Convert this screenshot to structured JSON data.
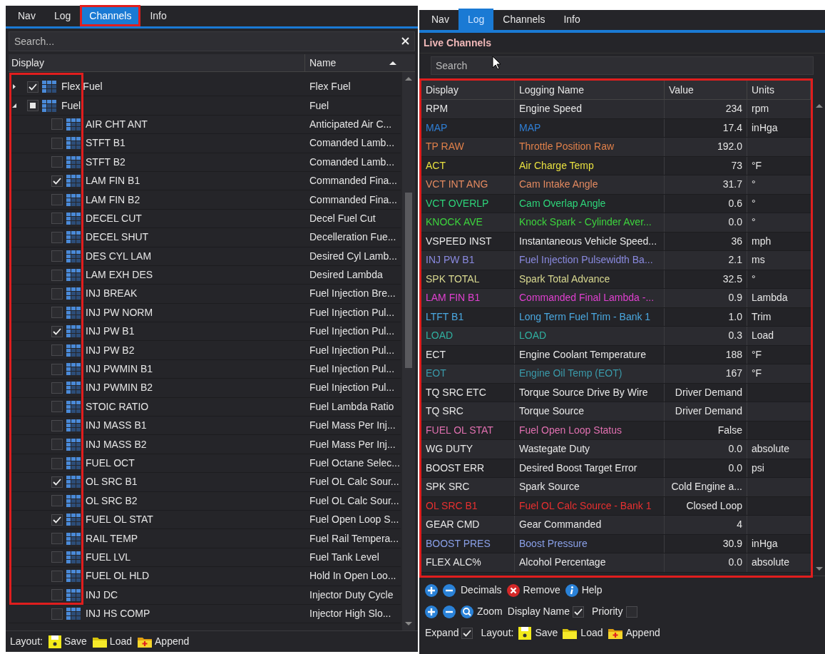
{
  "left_panel": {
    "tabs": [
      {
        "label": "Nav",
        "selected": false,
        "annotated": false
      },
      {
        "label": "Log",
        "selected": false,
        "annotated": false
      },
      {
        "label": "Channels",
        "selected": true,
        "annotated": true
      },
      {
        "label": "Info",
        "selected": false,
        "annotated": false
      }
    ],
    "search": {
      "placeholder": "Search..."
    },
    "tree": {
      "columns": [
        {
          "label": "Display"
        },
        {
          "label": "Name",
          "sorted": true
        }
      ],
      "annotated": true,
      "nodes": [
        {
          "display": "Flex Fuel",
          "name": "Flex Fuel",
          "checked": true,
          "expanded": false
        },
        {
          "display": "Fuel",
          "name": "Fuel",
          "checked": false,
          "partial": true,
          "expanded": true,
          "children": [
            {
              "display": "AIR CHT ANT",
              "name": "Anticipated Air C...",
              "checked": false
            },
            {
              "display": "STFT B1",
              "name": "Comanded Lamb...",
              "checked": false
            },
            {
              "display": "STFT B2",
              "name": "Comanded Lamb...",
              "checked": false
            },
            {
              "display": "LAM FIN B1",
              "name": "Commanded Fina...",
              "checked": true
            },
            {
              "display": "LAM FIN B2",
              "name": "Commanded Fina...",
              "checked": false
            },
            {
              "display": "DECEL CUT",
              "name": "Decel Fuel Cut",
              "checked": false
            },
            {
              "display": "DECEL SHUT",
              "name": "Decelleration Fue...",
              "checked": false
            },
            {
              "display": "DES CYL LAM",
              "name": "Desired Cyl Lamb...",
              "checked": false
            },
            {
              "display": "LAM EXH DES",
              "name": "Desired Lambda",
              "checked": false
            },
            {
              "display": "INJ BREAK",
              "name": "Fuel Injection Bre...",
              "checked": false
            },
            {
              "display": "INJ PW NORM",
              "name": "Fuel Injection Pul...",
              "checked": false
            },
            {
              "display": "INJ PW B1",
              "name": "Fuel Injection Pul...",
              "checked": true
            },
            {
              "display": "INJ PW B2",
              "name": "Fuel Injection Pul...",
              "checked": false
            },
            {
              "display": "INJ PWMIN B1",
              "name": "Fuel Injection Pul...",
              "checked": false
            },
            {
              "display": "INJ PWMIN B2",
              "name": "Fuel Injection Pul...",
              "checked": false
            },
            {
              "display": "STOIC RATIO",
              "name": "Fuel Lambda Ratio",
              "checked": false
            },
            {
              "display": "INJ MASS B1",
              "name": "Fuel Mass Per Inj...",
              "checked": false
            },
            {
              "display": "INJ MASS B2",
              "name": "Fuel Mass Per Inj...",
              "checked": false
            },
            {
              "display": "FUEL OCT",
              "name": "Fuel Octane Selec...",
              "checked": false
            },
            {
              "display": "OL SRC B1",
              "name": "Fuel OL Calc Sour...",
              "checked": true
            },
            {
              "display": "OL SRC B2",
              "name": "Fuel OL Calc Sour...",
              "checked": false
            },
            {
              "display": "FUEL OL STAT",
              "name": "Fuel Open Loop S...",
              "checked": true
            },
            {
              "display": "RAIL TEMP",
              "name": "Fuel Rail Tempera...",
              "checked": false
            },
            {
              "display": "FUEL LVL",
              "name": "Fuel Tank Level",
              "checked": false
            },
            {
              "display": "FUEL OL HLD",
              "name": "Hold In Open Loo...",
              "checked": false
            },
            {
              "display": "INJ DC",
              "name": "Injector Duty Cycle",
              "checked": false
            },
            {
              "display": "INJ HS COMP",
              "name": "Injector High Slo...",
              "checked": false
            }
          ]
        }
      ]
    },
    "footer": {
      "label": "Layout:",
      "buttons": [
        {
          "kind": "save",
          "label": "Save"
        },
        {
          "kind": "load",
          "label": "Load"
        },
        {
          "kind": "append",
          "label": "Append"
        }
      ]
    }
  },
  "right_panel": {
    "tabs": [
      {
        "label": "Nav",
        "selected": false
      },
      {
        "label": "Log",
        "selected": true
      },
      {
        "label": "Channels",
        "selected": false
      },
      {
        "label": "Info",
        "selected": false
      }
    ],
    "title": "Live Channels",
    "search": {
      "placeholder": "Search"
    },
    "table": {
      "annotated": true,
      "columns": [
        "Display",
        "Logging Name",
        "Value",
        "Units"
      ],
      "rows": [
        {
          "display": "RPM",
          "logging_name": "Engine Speed",
          "value": "234",
          "units": "rpm",
          "color": "#e8e8e8"
        },
        {
          "display": "MAP",
          "logging_name": "MAP",
          "value": "17.4",
          "units": "inHga",
          "color": "#2f7fd6"
        },
        {
          "display": "TP RAW",
          "logging_name": "Throttle Position Raw",
          "value": "192.0",
          "color": "#e0804a"
        },
        {
          "display": "ACT",
          "logging_name": "Air Charge Temp",
          "value": "73",
          "units": "°F",
          "color": "#e8e040"
        },
        {
          "display": "VCT INT ANG",
          "logging_name": "Cam Intake Angle",
          "value": "31.7",
          "units": "°",
          "color": "#e48a60"
        },
        {
          "display": "VCT OVERLP",
          "logging_name": "Cam Overlap Angle",
          "value": "0.6",
          "units": "°",
          "color": "#2ed47a"
        },
        {
          "display": "KNOCK AVE",
          "logging_name": "Knock Spark - Cylinder Aver...",
          "value": "0.0",
          "units": "°",
          "color": "#3dd43d"
        },
        {
          "display": "VSPEED INST",
          "logging_name": "Instantaneous Vehicle Speed...",
          "value": "36",
          "units": "mph",
          "color": "#e8e8e8"
        },
        {
          "display": "INJ PW B1",
          "logging_name": "Fuel Injection Pulsewidth Ba...",
          "value": "2.1",
          "units": "ms",
          "color": "#8a8ae0"
        },
        {
          "display": "SPK TOTAL",
          "logging_name": "Spark Total Advance",
          "value": "32.5",
          "units": "°",
          "color": "#d8d890"
        },
        {
          "display": "LAM FIN B1",
          "logging_name": "Commanded Final Lambda -...",
          "value": "0.9",
          "units": "Lambda",
          "color": "#e040d0"
        },
        {
          "display": "LTFT B1",
          "logging_name": "Long Term Fuel Trim - Bank 1",
          "value": "1.0",
          "units": "Trim",
          "color": "#4aa8e0"
        },
        {
          "display": "LOAD",
          "logging_name": "LOAD",
          "value": "0.3",
          "units": "Load",
          "color": "#30b0a0"
        },
        {
          "display": "ECT",
          "logging_name": "Engine Coolant Temperature",
          "value": "188",
          "units": "°F",
          "color": "#e8e8e8"
        },
        {
          "display": "EOT",
          "logging_name": "Engine Oil Temp (EOT)",
          "value": "167",
          "units": "°F",
          "color": "#3a9aaa"
        },
        {
          "display": "TQ SRC ETC",
          "logging_name": "Torque Source Drive By Wire",
          "value": "Driver Demand",
          "color": "#e8e8e8"
        },
        {
          "display": "TQ SRC",
          "logging_name": "Torque Source",
          "value": "Driver Demand",
          "color": "#e8e8e8"
        },
        {
          "display": "FUEL OL STAT",
          "logging_name": "Fuel Open Loop Status",
          "value": "False",
          "color": "#e070b0"
        },
        {
          "display": "WG DUTY",
          "logging_name": "Wastegate Duty",
          "value": "0.0",
          "units": "absolute",
          "color": "#e8e8e8"
        },
        {
          "display": "BOOST ERR",
          "logging_name": "Desired Boost Target Error",
          "value": "0.0",
          "units": "psi",
          "color": "#e8e8e8"
        },
        {
          "display": "SPK SRC",
          "logging_name": "Spark Source",
          "value": "Cold Engine a...",
          "color": "#e8e8e8"
        },
        {
          "display": "OL SRC B1",
          "logging_name": "Fuel OL Calc Source - Bank 1",
          "value": "Closed Loop",
          "color": "#e83030"
        },
        {
          "display": "GEAR CMD",
          "logging_name": "Gear Commanded",
          "value": "4",
          "color": "#e8e8e8"
        },
        {
          "display": "BOOST PRES",
          "logging_name": "Boost Pressure",
          "value": "30.9",
          "units": "inHga",
          "color": "#8aa0e8"
        },
        {
          "display": "FLEX ALC%",
          "logging_name": "Alcohol Percentage",
          "value": "0.0",
          "units": "absolute",
          "color": "#e8e8e8"
        }
      ]
    },
    "toolbar_rows": [
      [
        {
          "kind": "plus"
        },
        {
          "kind": "minus"
        },
        {
          "kind": "text",
          "label": "Decimals"
        },
        {
          "kind": "remove",
          "label": "Remove"
        },
        {
          "kind": "help",
          "label": "Help"
        }
      ],
      [
        {
          "kind": "plus"
        },
        {
          "kind": "minus"
        },
        {
          "kind": "zoom",
          "label": "Zoom"
        },
        {
          "kind": "check",
          "label": "Display Name",
          "checked": true
        },
        {
          "kind": "check",
          "label": "Priority",
          "checked": false
        }
      ],
      [
        {
          "kind": "check",
          "label": "Expand",
          "checked": true
        },
        {
          "kind": "text",
          "label": "Layout:"
        },
        {
          "kind": "save",
          "label": "Save"
        },
        {
          "kind": "load",
          "label": "Load"
        },
        {
          "kind": "append",
          "label": "Append"
        }
      ]
    ]
  }
}
